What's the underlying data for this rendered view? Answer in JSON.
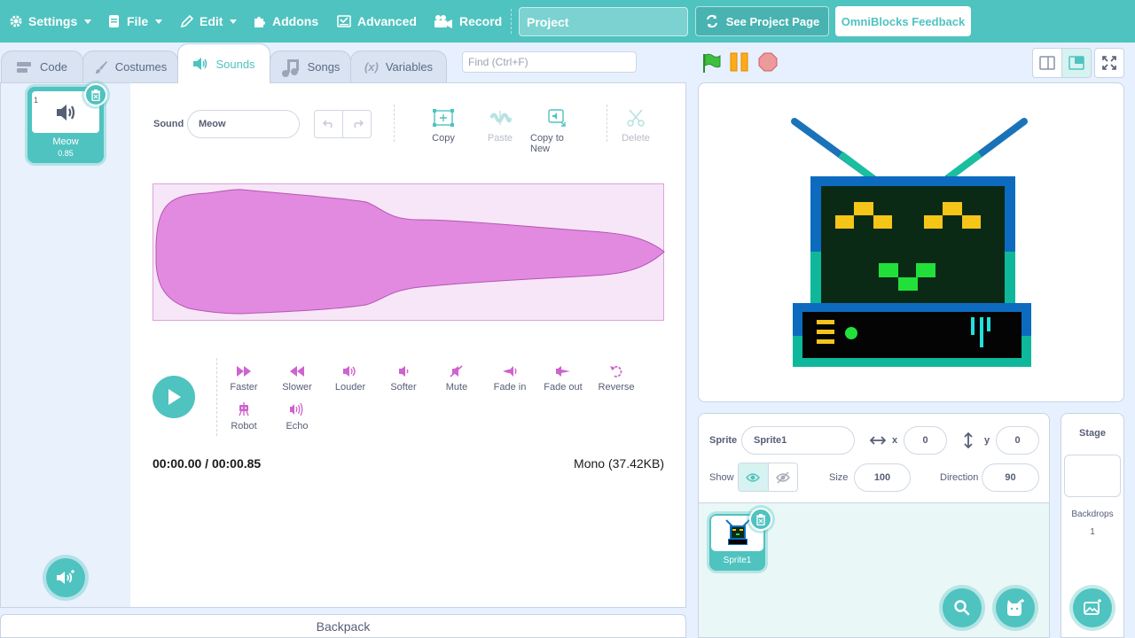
{
  "menubar": {
    "settings": "Settings",
    "file": "File",
    "edit": "Edit",
    "addons": "Addons",
    "advanced": "Advanced",
    "record": "Record",
    "project_title": "Project",
    "see_project_page": "See Project Page",
    "feedback": "OmniBlocks Feedback"
  },
  "tabs": [
    {
      "label": "Code",
      "icon": "code-icon"
    },
    {
      "label": "Costumes",
      "icon": "brush-icon"
    },
    {
      "label": "Sounds",
      "icon": "speaker-icon"
    },
    {
      "label": "Songs",
      "icon": "music-note-icon"
    },
    {
      "label": "Variables",
      "icon": "variable-icon"
    }
  ],
  "find": {
    "placeholder": "Find (Ctrl+F)"
  },
  "sound_list": {
    "items": [
      {
        "index": "1",
        "name": "Meow",
        "duration": "0.85"
      }
    ]
  },
  "editor": {
    "sound_label": "Sound",
    "sound_name": "Meow",
    "tools": {
      "copy": "Copy",
      "paste": "Paste",
      "copy_to_new": "Copy to New",
      "delete": "Delete"
    },
    "effects": [
      "Faster",
      "Slower",
      "Louder",
      "Softer",
      "Mute",
      "Fade in",
      "Fade out",
      "Reverse",
      "Robot",
      "Echo"
    ],
    "time": "00:00.00 / 00:00.85",
    "format": "Mono (37.42KB)"
  },
  "backpack": "Backpack",
  "sprite_info": {
    "sprite_label": "Sprite",
    "sprite_name": "Sprite1",
    "x_label": "x",
    "x": "0",
    "y_label": "y",
    "y": "0",
    "show_label": "Show",
    "size_label": "Size",
    "size": "100",
    "direction_label": "Direction",
    "direction": "90"
  },
  "sprites": [
    {
      "name": "Sprite1"
    }
  ],
  "stage_panel": {
    "title": "Stage",
    "backdrops_label": "Backdrops",
    "backdrops_count": "1"
  },
  "colors": {
    "accent": "#4fc3c0",
    "sound_purple": "#cf63cf",
    "stage_bg": "#ffffff"
  }
}
